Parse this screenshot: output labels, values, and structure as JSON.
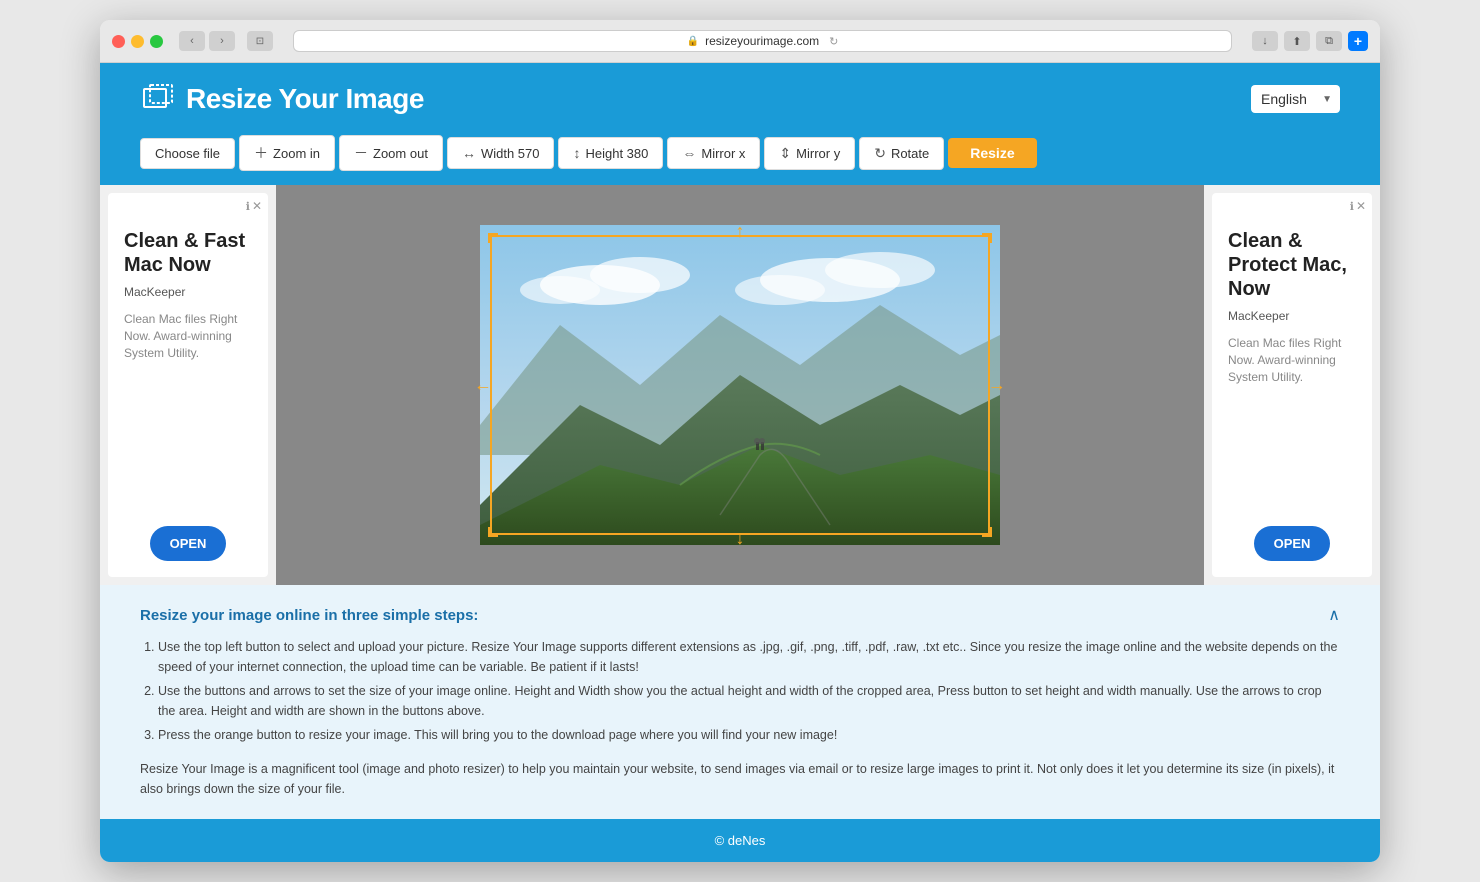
{
  "browser": {
    "url": "resizeyourimage.com",
    "back_icon": "‹",
    "forward_icon": "›",
    "reader_icon": "⊡",
    "share_icon": "⬆",
    "tabs_icon": "⧉",
    "add_icon": "+",
    "download_icon": "↓"
  },
  "header": {
    "logo_text": "Resize Your Image",
    "language": "English"
  },
  "toolbar": {
    "choose_file_label": "Choose file",
    "zoom_in_label": "Zoom in",
    "zoom_out_label": "Zoom out",
    "width_label": "Width 570",
    "height_label": "Height 380",
    "mirror_x_label": "Mirror x",
    "mirror_y_label": "Mirror y",
    "rotate_label": "Rotate",
    "resize_label": "Resize"
  },
  "ad_left": {
    "title": "Clean & Fast Mac Now",
    "brand": "MacKeeper",
    "description": "Clean Mac files Right Now. Award-winning System Utility.",
    "open_label": "OPEN"
  },
  "ad_right": {
    "title": "Clean & Protect Mac, Now",
    "brand": "MacKeeper",
    "description": "Clean Mac files Right Now. Award-winning System Utility.",
    "open_label": "OPEN"
  },
  "info": {
    "title": "Resize your image online in three simple steps:",
    "steps": [
      "Use the top left button to select and upload your picture. Resize Your Image supports different extensions as .jpg, .gif, .png, .tiff, .pdf, .raw, .txt etc.. Since you resize the image online and the website depends on the speed of your internet connection, the upload time can be variable. Be patient if it lasts!",
      "Use the buttons and arrows to set the size of your image online. Height and Width show you the actual height and width of the cropped area, Press button to set height and width manually. Use the arrows to crop the area. Height and width are shown in the buttons above.",
      "Press the orange button to resize your image. This will bring you to the download page where you will find your new image!"
    ],
    "description": "Resize Your Image is a magnificent tool (image and photo resizer) to help you maintain your website, to send images via email or to resize large images to print it. Not only does it let you determine its size (in pixels), it also brings down the size of your file."
  },
  "footer": {
    "copyright": "© deNes"
  }
}
